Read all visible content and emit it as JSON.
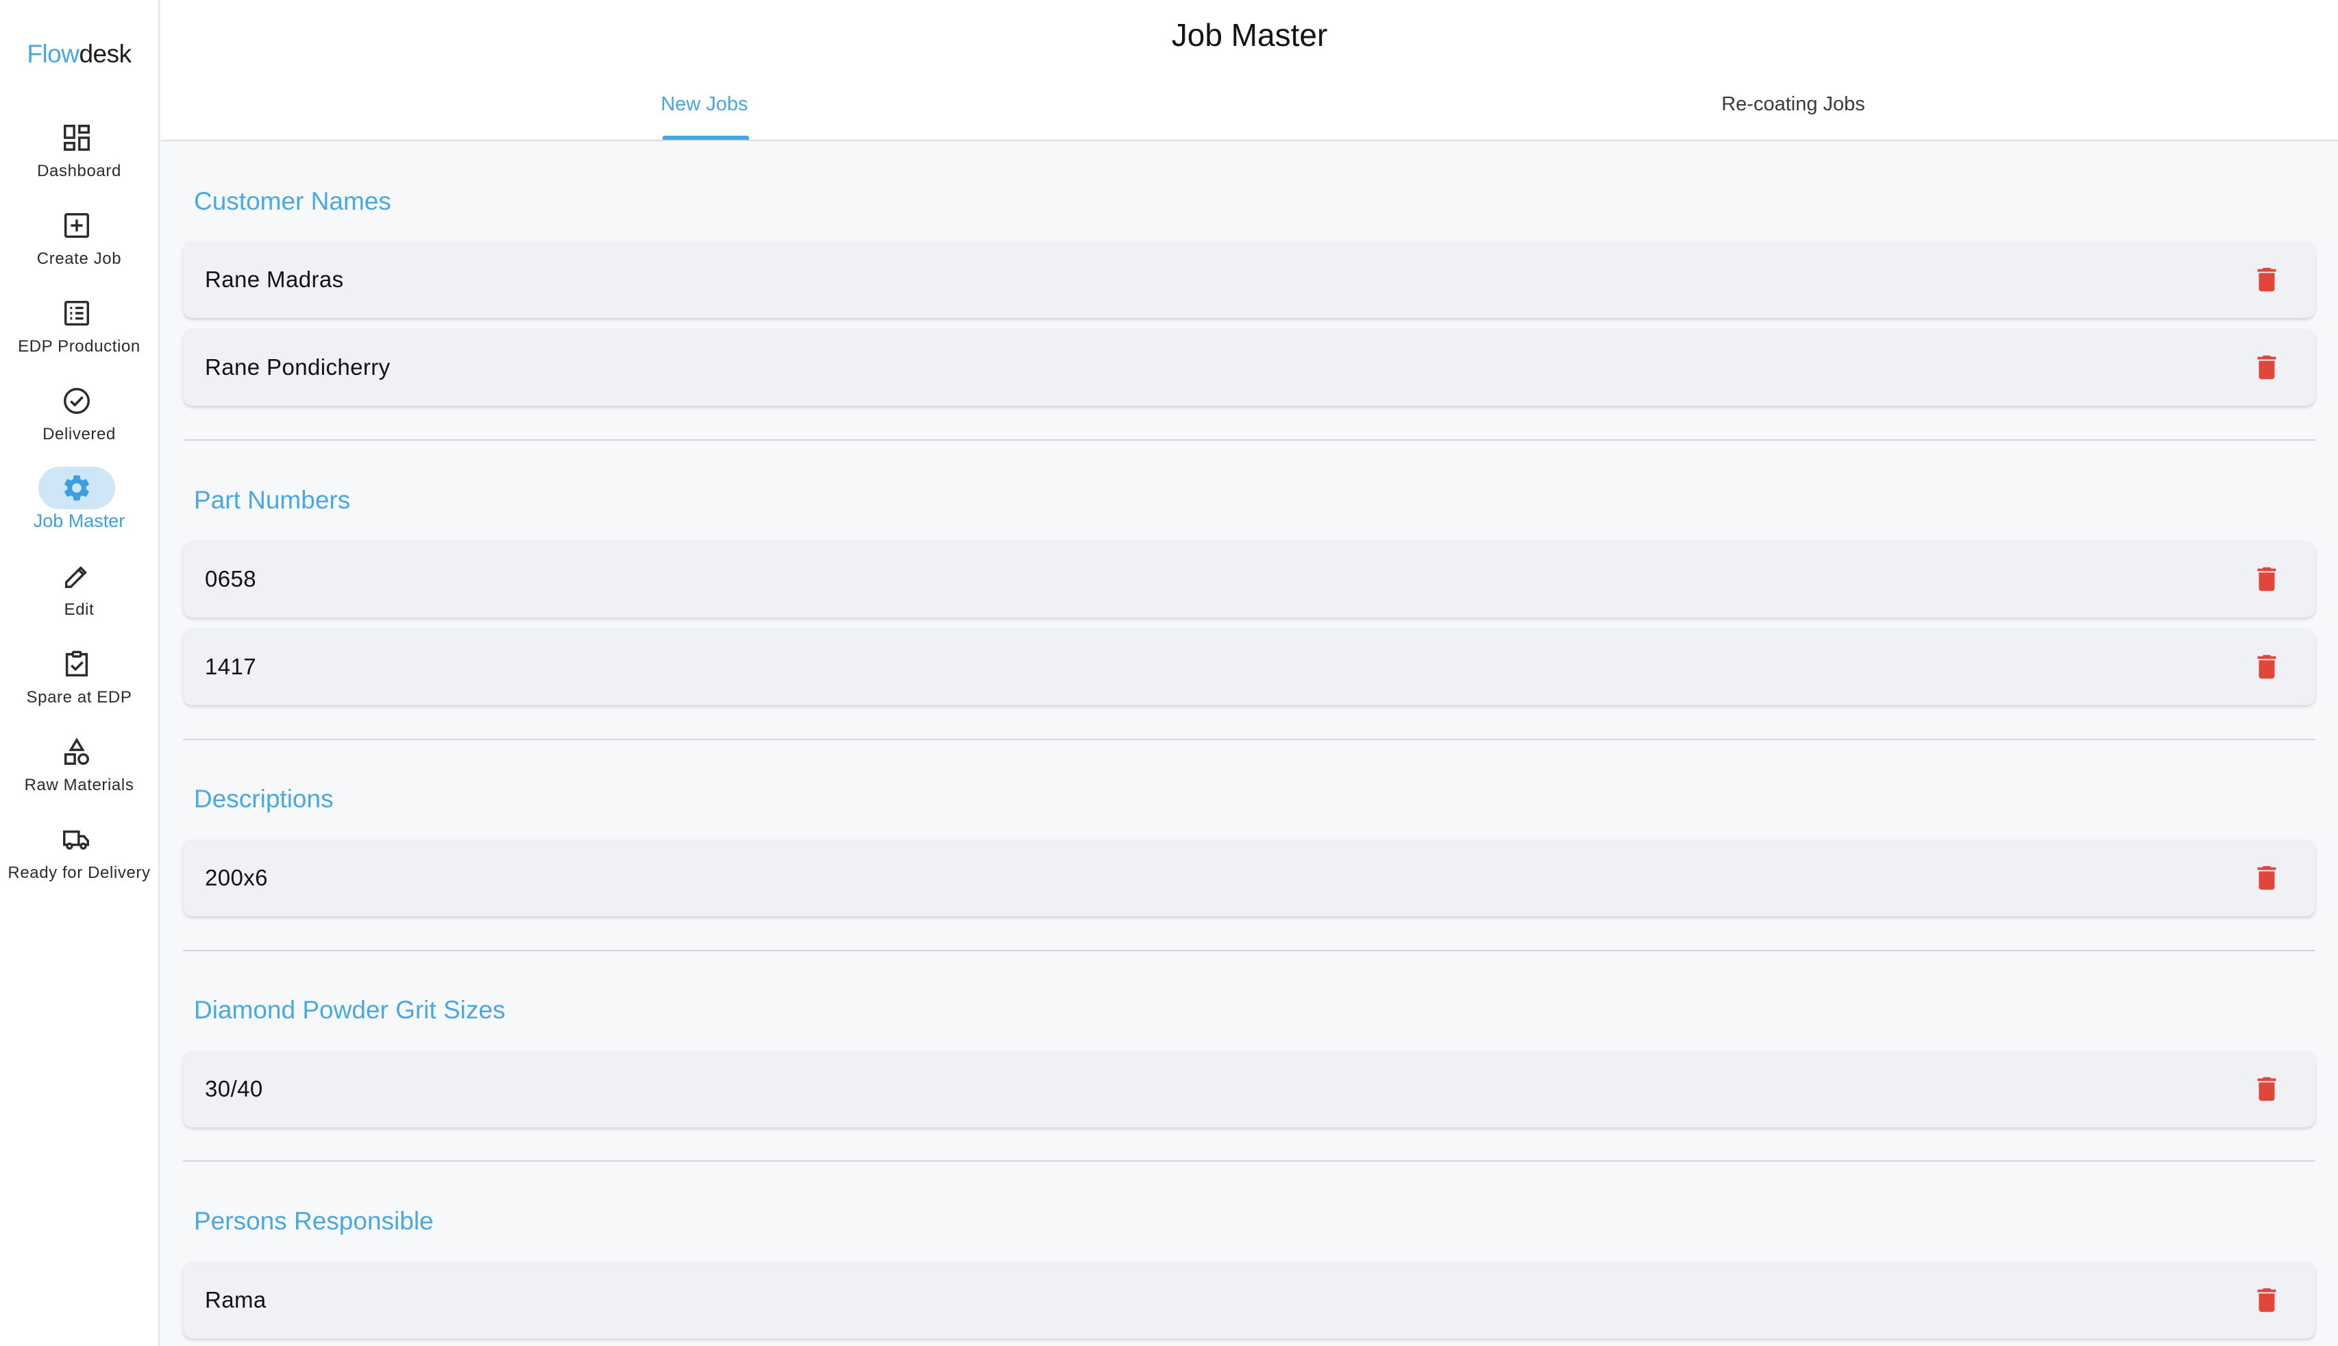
{
  "app": {
    "logo_part1": "Flow",
    "logo_part2": "desk"
  },
  "sidebar": {
    "items": [
      {
        "label": "Dashboard",
        "icon": "dashboard-icon"
      },
      {
        "label": "Create Job",
        "icon": "add-box-icon"
      },
      {
        "label": "EDP Production",
        "icon": "list-icon"
      },
      {
        "label": "Delivered",
        "icon": "check-circle-icon"
      },
      {
        "label": "Job Master",
        "icon": "gear-icon",
        "active": true
      },
      {
        "label": "Edit",
        "icon": "pencil-icon"
      },
      {
        "label": "Spare at EDP",
        "icon": "clipboard-check-icon"
      },
      {
        "label": "Raw Materials",
        "icon": "shapes-icon"
      },
      {
        "label": "Ready for Delivery",
        "icon": "truck-icon"
      }
    ]
  },
  "header": {
    "title": "Job Master",
    "tabs": [
      {
        "label": "New Jobs",
        "active": true
      },
      {
        "label": "Re-coating Jobs",
        "active": false
      }
    ]
  },
  "sections": [
    {
      "title": "Customer Names",
      "items": [
        "Rane Madras",
        "Rane Pondicherry"
      ]
    },
    {
      "title": "Part Numbers",
      "items": [
        "0658",
        "1417"
      ]
    },
    {
      "title": "Descriptions",
      "items": [
        "200x6"
      ]
    },
    {
      "title": "Diamond Powder Grit Sizes",
      "items": [
        "30/40"
      ]
    },
    {
      "title": "Persons Responsible",
      "items": [
        "Rama"
      ]
    }
  ],
  "colors": {
    "accent": "#4aa8e0",
    "delete": "#e0473a",
    "active_pill": "#cfe6f7"
  }
}
